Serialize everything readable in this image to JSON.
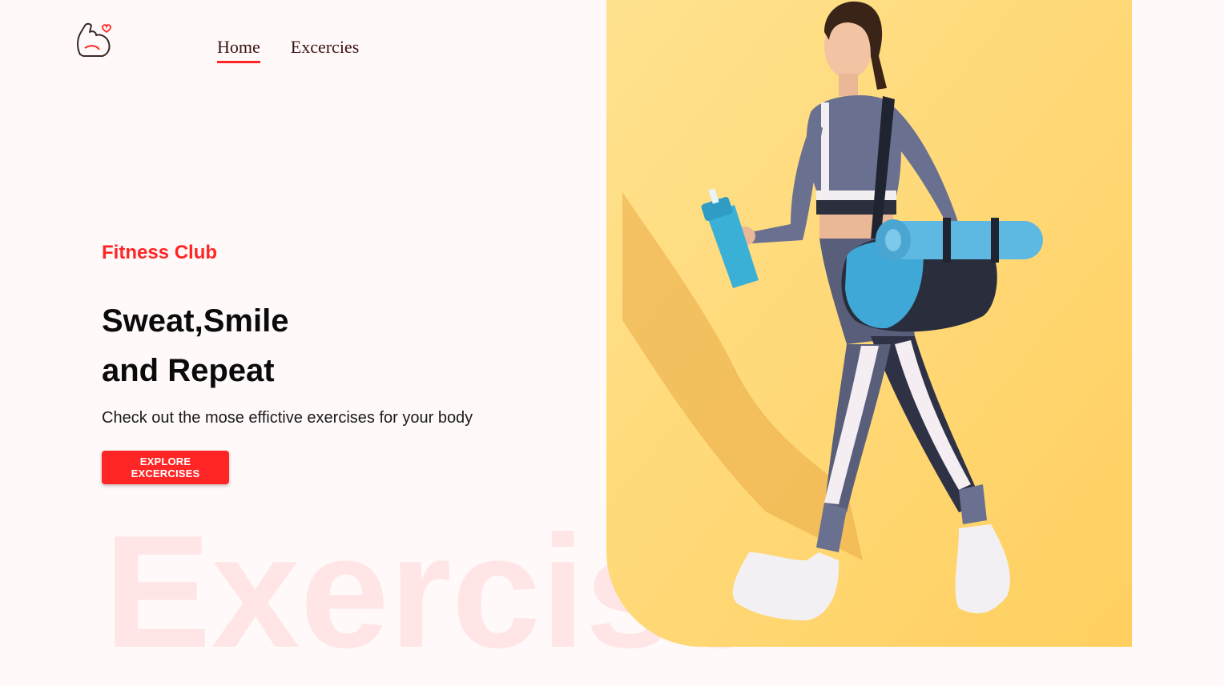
{
  "brand": {
    "logo_icon": "flexed-arm-heart-icon",
    "accent_color": "#ff2625"
  },
  "nav": {
    "items": [
      {
        "label": "Home",
        "active": true
      },
      {
        "label": "Excercies",
        "active": false
      }
    ]
  },
  "hero": {
    "kicker": "Fitness Club",
    "headline_line1": "Sweat,Smile",
    "headline_line2": "and Repeat",
    "subline": "Check out the mose effictive exercises for your body",
    "cta_label": "EXPLORE EXCERCISES",
    "background_word": "Exercise",
    "image_description_icon": "woman-walking-with-gym-bag-image"
  }
}
